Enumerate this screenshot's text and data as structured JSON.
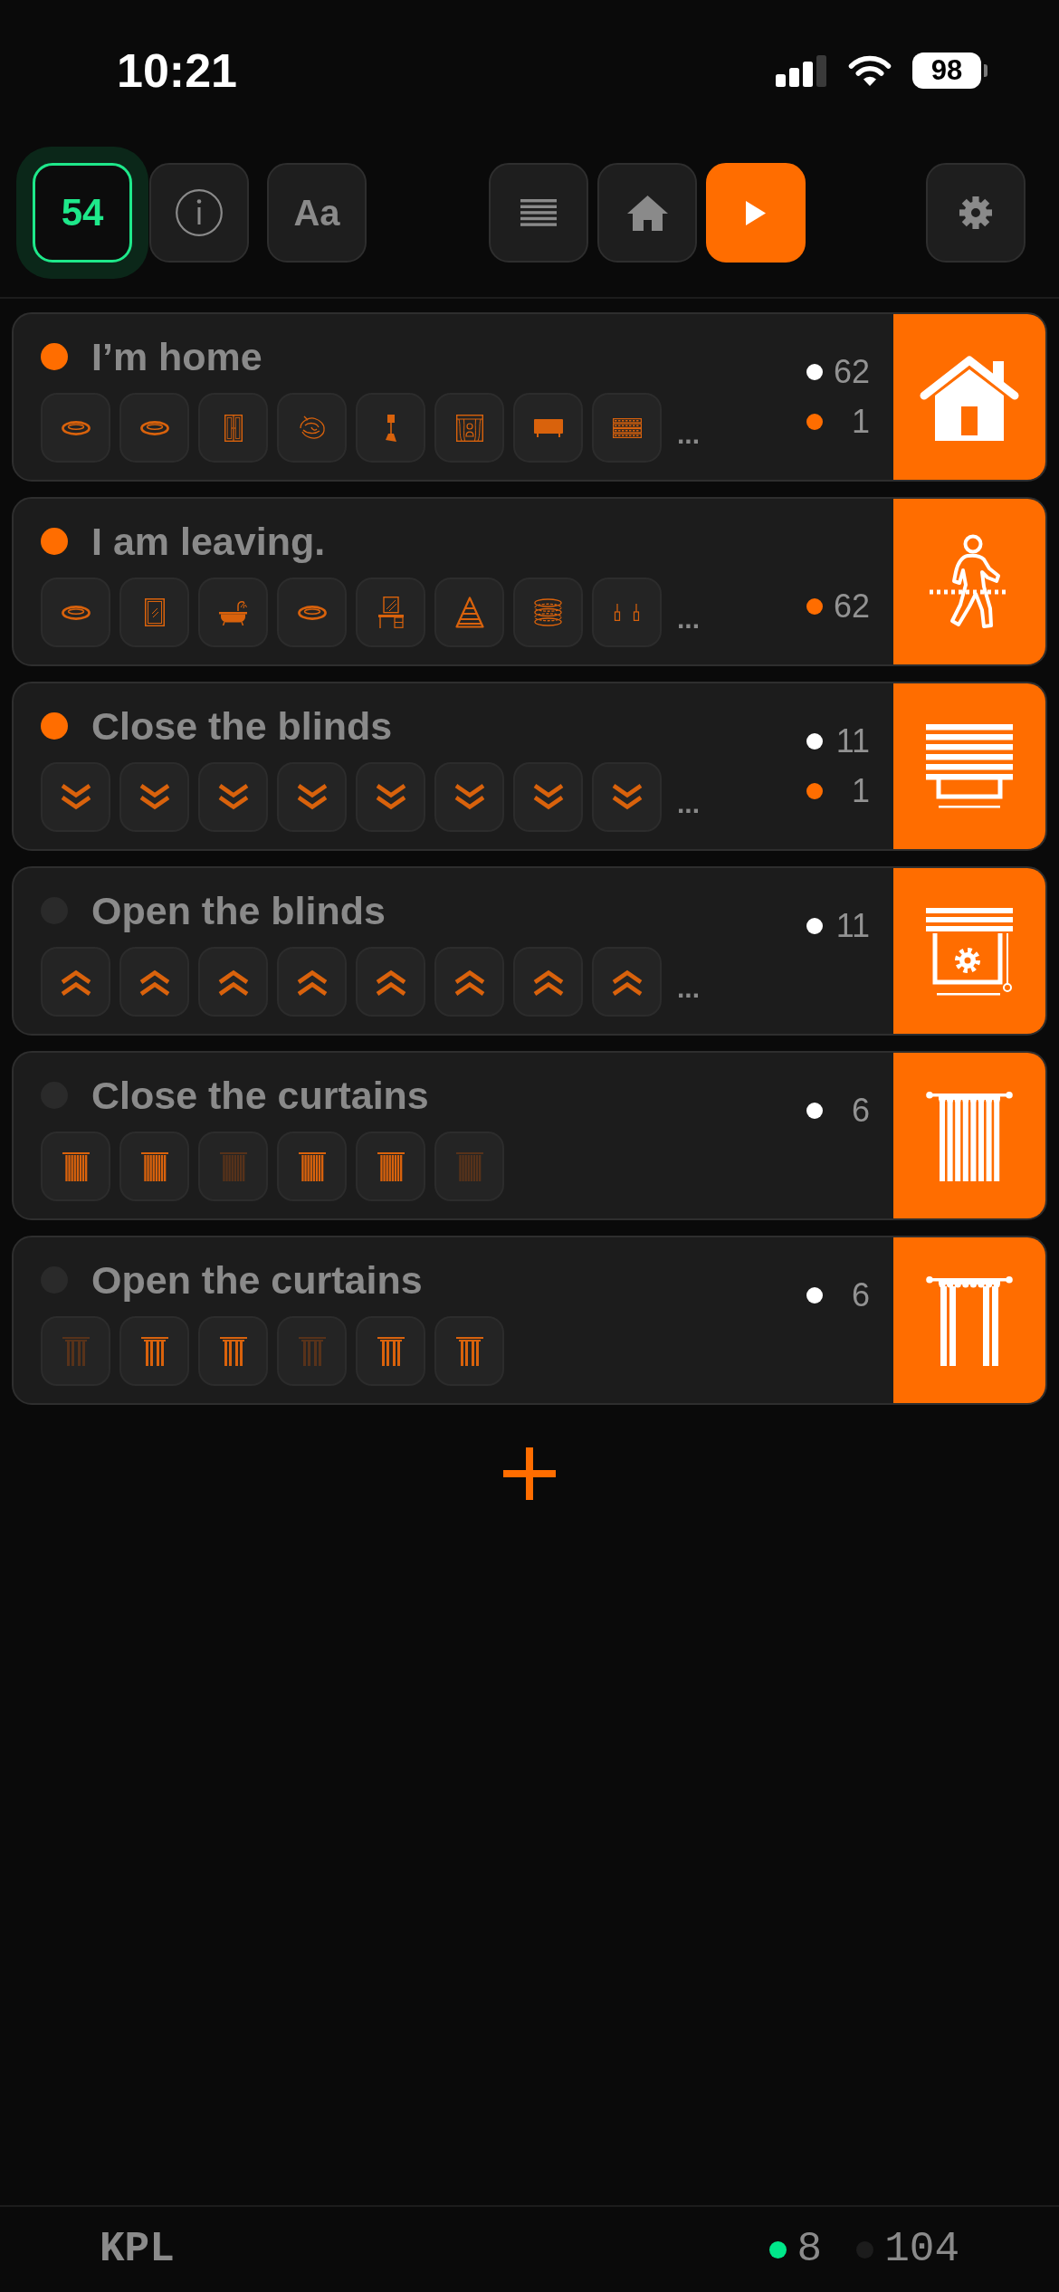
{
  "status_bar": {
    "time": "10:21",
    "battery": "98"
  },
  "toolbar": {
    "left": [
      {
        "kind": "counter",
        "label": "54"
      },
      {
        "kind": "info"
      },
      {
        "kind": "font",
        "label": "Aa"
      }
    ],
    "views": [
      {
        "kind": "list",
        "selected": false
      },
      {
        "kind": "home",
        "selected": false
      },
      {
        "kind": "play",
        "selected": true
      }
    ],
    "right": [
      {
        "kind": "settings"
      }
    ]
  },
  "scenes": [
    {
      "kind": "house",
      "title": "I’m home",
      "active": true,
      "devices": [
        {
          "kind": "ceiling-lamp",
          "dimmed": false
        },
        {
          "kind": "ceiling-lamp",
          "dimmed": false
        },
        {
          "kind": "wardrobe",
          "dimmed": false
        },
        {
          "kind": "chandelier",
          "dimmed": false
        },
        {
          "kind": "floor-lamp",
          "dimmed": false
        },
        {
          "kind": "window-curtain",
          "dimmed": false
        },
        {
          "kind": "tv",
          "dimmed": false
        },
        {
          "kind": "led-panel",
          "dimmed": false
        }
      ],
      "more": "...",
      "counts": [
        {
          "kind": "primary",
          "color": "#ffffff",
          "value": "62"
        },
        {
          "kind": "secondary",
          "color": "#ff6d00",
          "value": "1"
        }
      ]
    },
    {
      "kind": "walker",
      "title": "I am leaving.",
      "active": true,
      "devices": [
        {
          "kind": "ceiling-lamp",
          "dimmed": false
        },
        {
          "kind": "mirror",
          "dimmed": false
        },
        {
          "kind": "bathtub",
          "dimmed": false
        },
        {
          "kind": "ceiling-lamp",
          "dimmed": false
        },
        {
          "kind": "vanity",
          "dimmed": false
        },
        {
          "kind": "staircase",
          "dimmed": false
        },
        {
          "kind": "coil",
          "dimmed": false
        },
        {
          "kind": "pendant-lamps",
          "dimmed": false
        }
      ],
      "more": "...",
      "counts": [
        {
          "kind": "secondary",
          "color": "#ff6d00",
          "value": "62"
        }
      ]
    },
    {
      "kind": "blinds",
      "title": "Close the blinds",
      "active": true,
      "devices": [
        {
          "kind": "chevrons-down",
          "dimmed": false
        },
        {
          "kind": "chevrons-down",
          "dimmed": false
        },
        {
          "kind": "chevrons-down",
          "dimmed": false
        },
        {
          "kind": "chevrons-down",
          "dimmed": false
        },
        {
          "kind": "chevrons-down",
          "dimmed": false
        },
        {
          "kind": "chevrons-down",
          "dimmed": false
        },
        {
          "kind": "chevrons-down",
          "dimmed": false
        },
        {
          "kind": "chevrons-down",
          "dimmed": false
        }
      ],
      "more": "...",
      "counts": [
        {
          "kind": "primary",
          "color": "#ffffff",
          "value": "11"
        },
        {
          "kind": "secondary",
          "color": "#ff6d00",
          "value": "1"
        }
      ]
    },
    {
      "kind": "blinds-gear",
      "title": "Open the blinds",
      "active": false,
      "devices": [
        {
          "kind": "chevrons-up",
          "dimmed": false
        },
        {
          "kind": "chevrons-up",
          "dimmed": false
        },
        {
          "kind": "chevrons-up",
          "dimmed": false
        },
        {
          "kind": "chevrons-up",
          "dimmed": false
        },
        {
          "kind": "chevrons-up",
          "dimmed": false
        },
        {
          "kind": "chevrons-up",
          "dimmed": false
        },
        {
          "kind": "chevrons-up",
          "dimmed": false
        },
        {
          "kind": "chevrons-up",
          "dimmed": false
        }
      ],
      "more": "...",
      "counts": [
        {
          "kind": "primary",
          "color": "#ffffff",
          "value": "11"
        }
      ]
    },
    {
      "kind": "curtain-closed",
      "title": "Close the curtains",
      "active": false,
      "devices": [
        {
          "kind": "curtain-closed",
          "dimmed": false
        },
        {
          "kind": "curtain-closed",
          "dimmed": false
        },
        {
          "kind": "curtain-closed",
          "dimmed": true
        },
        {
          "kind": "curtain-closed",
          "dimmed": false
        },
        {
          "kind": "curtain-closed",
          "dimmed": false
        },
        {
          "kind": "curtain-closed",
          "dimmed": true
        }
      ],
      "counts": [
        {
          "kind": "primary",
          "color": "#ffffff",
          "value": "6"
        }
      ]
    },
    {
      "kind": "curtain-open",
      "title": "Open the curtains",
      "active": false,
      "devices": [
        {
          "kind": "curtain-open",
          "dimmed": true
        },
        {
          "kind": "curtain-open",
          "dimmed": false
        },
        {
          "kind": "curtain-open",
          "dimmed": false
        },
        {
          "kind": "curtain-open",
          "dimmed": true
        },
        {
          "kind": "curtain-open",
          "dimmed": false
        },
        {
          "kind": "curtain-open",
          "dimmed": false
        }
      ],
      "counts": [
        {
          "kind": "primary",
          "color": "#ffffff",
          "value": "6"
        }
      ]
    }
  ],
  "footer": {
    "label": "KPL",
    "counts": [
      {
        "color": "#00e88a",
        "value": "8"
      },
      {
        "color": "#1c1c1c",
        "value": "104"
      }
    ]
  }
}
